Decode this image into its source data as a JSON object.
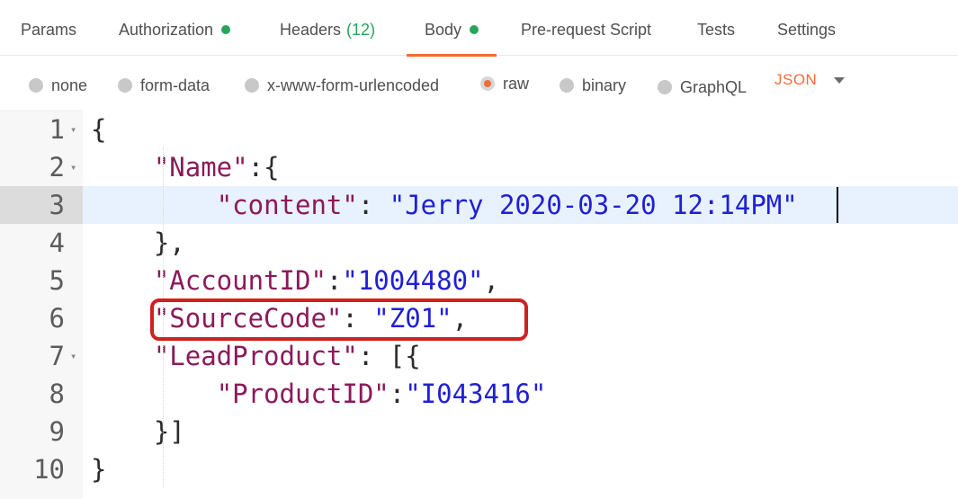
{
  "tabs": [
    {
      "label": "Params",
      "dot": false
    },
    {
      "label": "Authorization",
      "dot": true
    },
    {
      "label": "Headers",
      "count": "(12)"
    },
    {
      "label": "Body",
      "dot": true,
      "active": true
    },
    {
      "label": "Pre-request Script"
    },
    {
      "label": "Tests"
    },
    {
      "label": "Settings"
    }
  ],
  "body_modes": [
    {
      "label": "none",
      "selected": false
    },
    {
      "label": "form-data",
      "selected": false
    },
    {
      "label": "x-www-form-urlencoded",
      "selected": false
    },
    {
      "label": "raw",
      "selected": true
    },
    {
      "label": "binary",
      "selected": false
    },
    {
      "label": "GraphQL",
      "selected": false
    }
  ],
  "format": {
    "label": "JSON"
  },
  "editor": {
    "active_line": 3,
    "lines": [
      {
        "num": "1",
        "fold": "▾",
        "code": [
          {
            "t": "{",
            "c": "punc"
          }
        ]
      },
      {
        "num": "2",
        "fold": "▾",
        "code": [
          {
            "t": "    ",
            "c": "punc"
          },
          {
            "t": "\"Name\"",
            "c": "key"
          },
          {
            "t": ":{",
            "c": "punc"
          }
        ]
      },
      {
        "num": "3",
        "fold": "",
        "code": [
          {
            "t": "        ",
            "c": "punc"
          },
          {
            "t": "\"content\"",
            "c": "key"
          },
          {
            "t": ": ",
            "c": "punc"
          },
          {
            "t": "\"Jerry 2020-03-20 12:14PM\"",
            "c": "str"
          }
        ]
      },
      {
        "num": "4",
        "fold": "",
        "code": [
          {
            "t": "    },",
            "c": "punc"
          }
        ]
      },
      {
        "num": "5",
        "fold": "",
        "code": [
          {
            "t": "    ",
            "c": "punc"
          },
          {
            "t": "\"AccountID\"",
            "c": "key"
          },
          {
            "t": ":",
            "c": "punc"
          },
          {
            "t": "\"1004480\"",
            "c": "str"
          },
          {
            "t": ",",
            "c": "punc"
          }
        ]
      },
      {
        "num": "6",
        "fold": "",
        "code": [
          {
            "t": "    ",
            "c": "punc"
          },
          {
            "t": "\"SourceCode\"",
            "c": "key"
          },
          {
            "t": ": ",
            "c": "punc"
          },
          {
            "t": "\"Z01\"",
            "c": "str"
          },
          {
            "t": ",",
            "c": "punc"
          }
        ]
      },
      {
        "num": "7",
        "fold": "▾",
        "code": [
          {
            "t": "    ",
            "c": "punc"
          },
          {
            "t": "\"LeadProduct\"",
            "c": "key"
          },
          {
            "t": ": [{",
            "c": "punc"
          }
        ]
      },
      {
        "num": "8",
        "fold": "",
        "code": [
          {
            "t": "        ",
            "c": "punc"
          },
          {
            "t": "\"ProductID\"",
            "c": "key"
          },
          {
            "t": ":",
            "c": "punc"
          },
          {
            "t": "\"I043416\"",
            "c": "str"
          }
        ]
      },
      {
        "num": "9",
        "fold": "",
        "code": [
          {
            "t": "    }]",
            "c": "punc"
          }
        ]
      },
      {
        "num": "10",
        "fold": "",
        "code": [
          {
            "t": "}",
            "c": "punc"
          }
        ]
      }
    ]
  },
  "colors": {
    "accent": "#f26b3a",
    "status_green": "#26a55a",
    "key": "#8b1a5a",
    "string": "#1f1fd6",
    "highlight": "#d02020"
  }
}
